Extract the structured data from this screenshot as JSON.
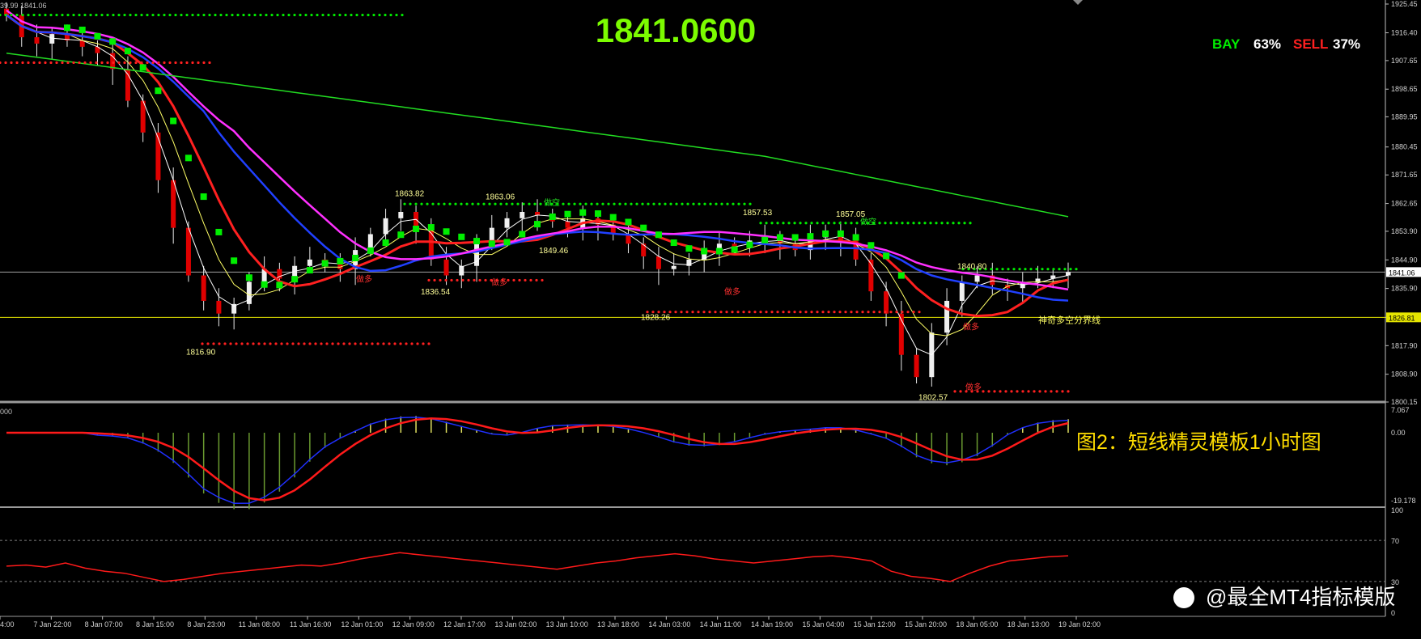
{
  "chart_data": {
    "type": "candlestick",
    "instrument_header": "39.99 1841.06",
    "current_price_big": "1841.0600",
    "sentiment": {
      "buy_label": "BAY",
      "buy_value": "63%",
      "sell_label": "SELL",
      "sell_value": "37%"
    },
    "price_axis": {
      "min": 1800.15,
      "max": 1925.45,
      "ticks": [
        "1925.45",
        "1916.40",
        "1907.65",
        "1898.65",
        "1889.95",
        "1880.45",
        "1871.65",
        "1862.65",
        "1853.90",
        "1844.90",
        "1835.90",
        "1826.81",
        "1817.90",
        "1808.90",
        "1800.15"
      ],
      "current_tag": "1841.06",
      "line_tag": "1826.81"
    },
    "time_axis": [
      "4:00",
      "7 Jan 22:00",
      "8 Jan 07:00",
      "8 Jan 15:00",
      "8 Jan 23:00",
      "11 Jan 08:00",
      "11 Jan 16:00",
      "12 Jan 01:00",
      "12 Jan 09:00",
      "12 Jan 17:00",
      "13 Jan 02:00",
      "13 Jan 10:00",
      "13 Jan 18:00",
      "14 Jan 03:00",
      "14 Jan 11:00",
      "14 Jan 19:00",
      "15 Jan 04:00",
      "15 Jan 12:00",
      "15 Jan 20:00",
      "18 Jan 05:00",
      "18 Jan 13:00",
      "19 Jan 02:00"
    ],
    "annotations": [
      "1863.82",
      "1863.06",
      "1857.53",
      "1857.05",
      "1840.80",
      "1849.46",
      "1836.54",
      "1828.26",
      "1816.90",
      "1802.57",
      "神奇多空分界线",
      "做多",
      "做空"
    ],
    "close_series": [
      1922,
      1915,
      1913,
      1916,
      1914,
      1912,
      1910,
      1905,
      1895,
      1885,
      1870,
      1855,
      1840,
      1832,
      1828,
      1831,
      1838,
      1842,
      1839,
      1843,
      1845,
      1844,
      1842,
      1848,
      1853,
      1858,
      1860,
      1855,
      1845,
      1840,
      1843,
      1850,
      1855,
      1858,
      1860,
      1859,
      1857,
      1855,
      1858,
      1856,
      1853,
      1850,
      1846,
      1842,
      1843,
      1845,
      1848,
      1850,
      1849,
      1851,
      1852,
      1850,
      1848,
      1852,
      1854,
      1851,
      1845,
      1835,
      1828,
      1815,
      1808,
      1822,
      1832,
      1838,
      1840,
      1837,
      1836,
      1838,
      1839,
      1840,
      1841.06
    ],
    "macd_panel": {
      "top_label": "7.067",
      "mid_label": "0.00",
      "bottom_label": "-19.178",
      "left_label": "000"
    },
    "rsi_panel": {
      "labels": [
        "100",
        "70",
        "30",
        "0"
      ],
      "values": [
        45,
        46,
        44,
        48,
        43,
        40,
        38,
        34,
        30,
        32,
        35,
        38,
        40,
        42,
        44,
        46,
        45,
        48,
        52,
        55,
        58,
        56,
        54,
        52,
        50,
        48,
        46,
        44,
        42,
        45,
        48,
        50,
        53,
        55,
        57,
        55,
        52,
        50,
        48,
        50,
        52,
        54,
        55,
        53,
        50,
        40,
        35,
        33,
        30,
        38,
        45,
        50,
        52,
        54,
        55
      ]
    },
    "caption": "图2：短线精灵模板1小时图",
    "watermark": "@最全MT4指标模版"
  }
}
